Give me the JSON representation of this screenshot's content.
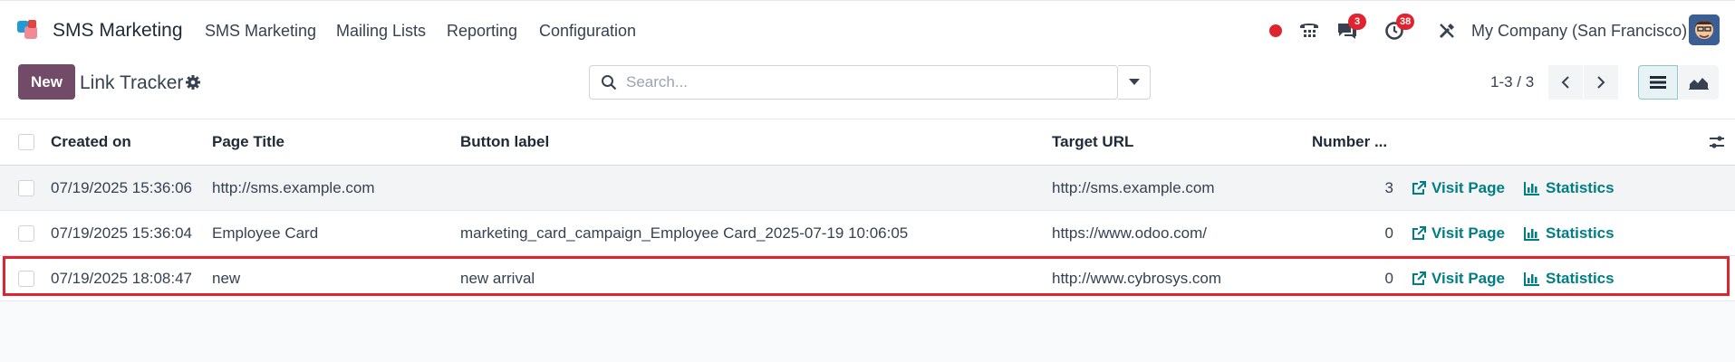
{
  "nav": {
    "app_name": "SMS Marketing",
    "menu": [
      "SMS Marketing",
      "Mailing Lists",
      "Reporting",
      "Configuration"
    ],
    "chat_badge": "3",
    "activity_badge": "38",
    "company": "My Company (San Francisco)"
  },
  "control": {
    "new_label": "New",
    "breadcrumb": "Link Tracker",
    "search_placeholder": "Search...",
    "pager": "1-3 / 3"
  },
  "table": {
    "headers": [
      "Created on",
      "Page Title",
      "Button label",
      "Target URL",
      "Number ..."
    ],
    "action_labels": {
      "visit": "Visit Page",
      "stats": "Statistics"
    },
    "rows": [
      {
        "created": "07/19/2025 15:36:06",
        "title": "http://sms.example.com",
        "label": "",
        "url": "http://sms.example.com",
        "count": "3"
      },
      {
        "created": "07/19/2025 15:36:04",
        "title": "Employee Card",
        "label": "marketing_card_campaign_Employee Card_2025-07-19 10:06:05",
        "url": "https://www.odoo.com/",
        "count": "0"
      },
      {
        "created": "07/19/2025 18:08:47",
        "title": "new",
        "label": "new arrival",
        "url": "http://www.cybrosys.com",
        "count": "0"
      }
    ]
  },
  "colors": {
    "brand": "#714b67",
    "link": "#017e84",
    "badge": "#e0242f",
    "highlight": "#e0242f"
  }
}
